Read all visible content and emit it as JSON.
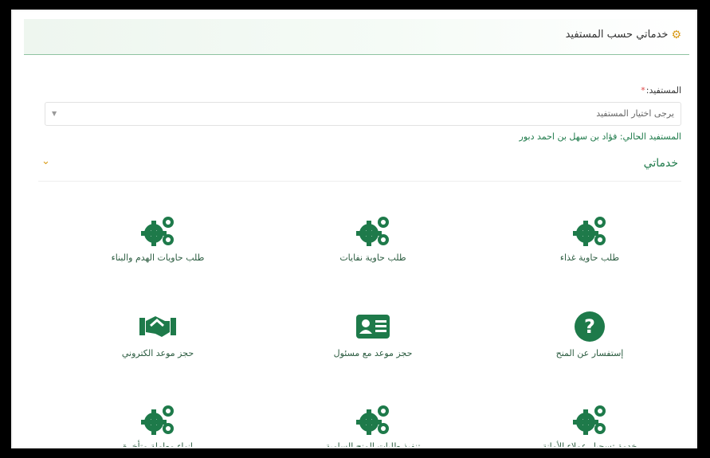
{
  "header": {
    "title": "خدماتي حسب المستفيد"
  },
  "form": {
    "beneficiary_label": "المستفيد:",
    "required_mark": "*",
    "select_placeholder": "يرجى اختيار المستفيد",
    "current_beneficiary": "المستفيد الحالي: فؤاد بن سهل بن احمد دبور"
  },
  "section": {
    "title": "خدماتي"
  },
  "services": [
    {
      "label": "طلب حاوية غذاء",
      "icon": "gears-icon"
    },
    {
      "label": "طلب حاوية نفايات",
      "icon": "gears-icon"
    },
    {
      "label": "طلب حاويات الهدم والبناء",
      "icon": "gears-icon"
    },
    {
      "label": "إستفسار عن المنح",
      "icon": "question-circle-icon"
    },
    {
      "label": "حجز موعد مع مسئول",
      "icon": "id-card-icon"
    },
    {
      "label": "حجز موعد الكتروني",
      "icon": "handshake-icon"
    },
    {
      "label": "خدمة تسجيل عملاء الأمانة",
      "icon": "gears-icon"
    },
    {
      "label": "تنفيذ طلبات المنح السامية",
      "icon": "gears-icon"
    },
    {
      "label": "إنهاء معاملة متأخرة",
      "icon": "gears-icon"
    }
  ],
  "colors": {
    "primary": "#1e7a4a",
    "accent": "#d99b18",
    "divider": "#8ec3a1"
  }
}
